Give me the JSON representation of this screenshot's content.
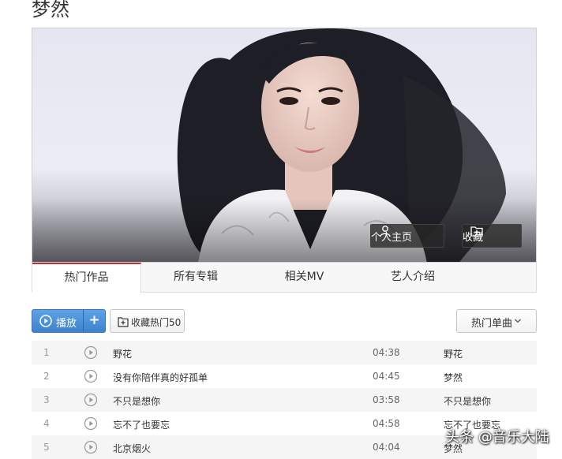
{
  "artist": {
    "name": "梦然"
  },
  "banner": {
    "home_label": "个人主页",
    "favorite_label": "收藏",
    "icons": {
      "home": "person-icon",
      "favorite": "folder-plus-icon"
    }
  },
  "tabs": [
    {
      "label": "热门作品",
      "active": true
    },
    {
      "label": "所有专辑",
      "active": false
    },
    {
      "label": "相关MV",
      "active": false
    },
    {
      "label": "艺人介绍",
      "active": false
    }
  ],
  "toolbar": {
    "play_label": "播放",
    "add_label": "+",
    "collect_label": "收藏热门50",
    "sort_label": "热门单曲",
    "accent": "#3c82cd"
  },
  "songs": [
    {
      "index": "1",
      "title": "野花",
      "duration": "04:38",
      "album": "野花"
    },
    {
      "index": "2",
      "title": "没有你陪伴真的好孤单",
      "duration": "04:45",
      "album": "梦然"
    },
    {
      "index": "3",
      "title": "不只是想你",
      "duration": "03:58",
      "album": "不只是想你"
    },
    {
      "index": "4",
      "title": "忘不了也要忘",
      "duration": "04:58",
      "album": "忘不了也要忘"
    },
    {
      "index": "5",
      "title": "北京烟火",
      "duration": "04:04",
      "album": "梦然"
    }
  ],
  "watermark": "头条 @音乐大陆"
}
